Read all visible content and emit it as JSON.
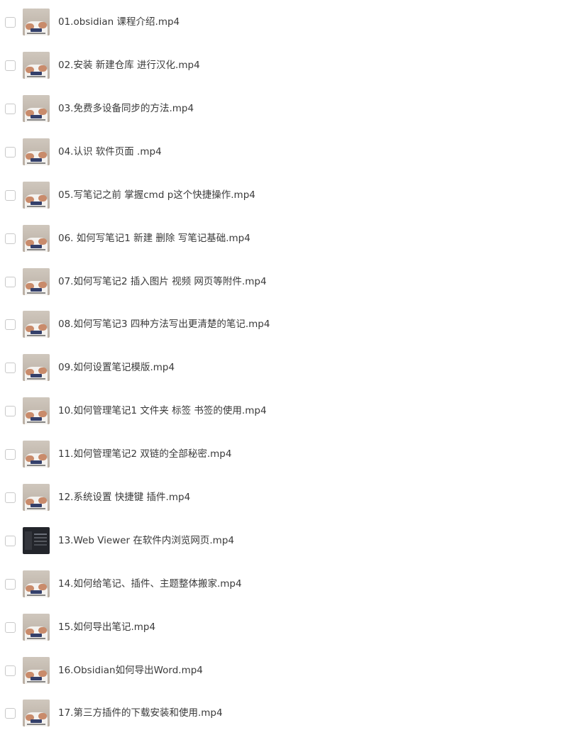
{
  "files": [
    {
      "name": "01.obsidian 课程介绍.mp4",
      "thumb": "presenter"
    },
    {
      "name": "02.安装 新建仓库 进行汉化.mp4",
      "thumb": "presenter"
    },
    {
      "name": "03.免费多设备同步的方法.mp4",
      "thumb": "presenter"
    },
    {
      "name": "04.认识 软件页面 .mp4",
      "thumb": "presenter"
    },
    {
      "name": "05.写笔记之前 掌握cmd p这个快捷操作.mp4",
      "thumb": "presenter"
    },
    {
      "name": "06. 如何写笔记1 新建 删除 写笔记基础.mp4",
      "thumb": "presenter"
    },
    {
      "name": "07.如何写笔记2 插入图片 视频 网页等附件.mp4",
      "thumb": "presenter"
    },
    {
      "name": "08.如何写笔记3 四种方法写出更清楚的笔记.mp4",
      "thumb": "presenter"
    },
    {
      "name": "09.如何设置笔记模版.mp4",
      "thumb": "presenter"
    },
    {
      "name": "10.如何管理笔记1 文件夹 标签 书签的使用.mp4",
      "thumb": "presenter"
    },
    {
      "name": "11.如何管理笔记2 双链的全部秘密.mp4",
      "thumb": "presenter"
    },
    {
      "name": "12.系统设置 快捷键 插件.mp4",
      "thumb": "presenter"
    },
    {
      "name": "13.Web Viewer 在软件内浏览网页.mp4",
      "thumb": "screen-dark"
    },
    {
      "name": "14.如何给笔记、插件、主题整体搬家.mp4",
      "thumb": "presenter"
    },
    {
      "name": "15.如何导出笔记.mp4",
      "thumb": "presenter"
    },
    {
      "name": "16.Obsidian如何导出Word.mp4",
      "thumb": "presenter"
    },
    {
      "name": "17.第三方插件的下载安装和使用.mp4",
      "thumb": "presenter"
    }
  ],
  "colors": {
    "text": "#3a3a3a",
    "checkbox_border": "#c9c9c9",
    "background": "#ffffff"
  }
}
